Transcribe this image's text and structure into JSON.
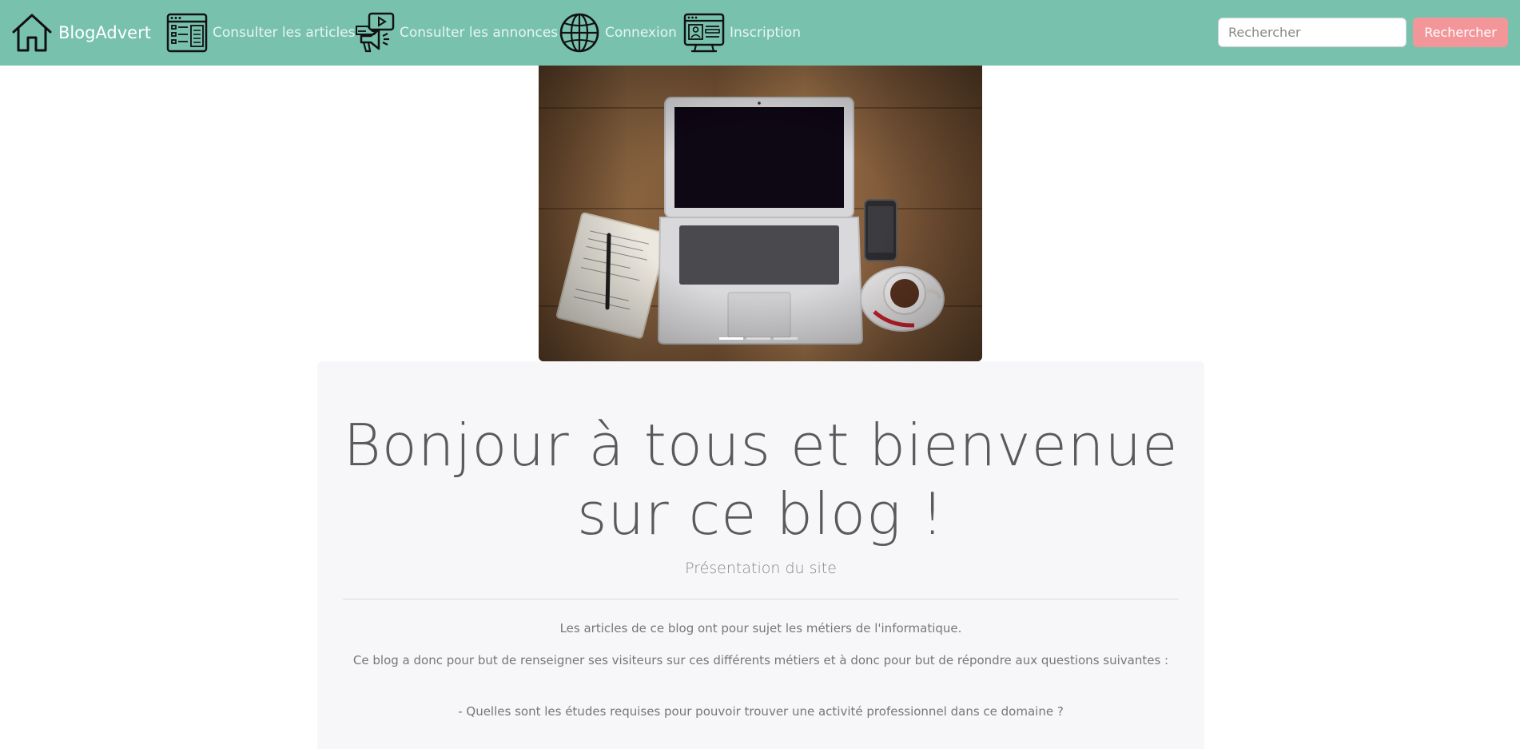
{
  "navbar": {
    "brand": "BlogAdvert",
    "links": [
      {
        "label": "Consulter les articles",
        "icon": "articles-icon"
      },
      {
        "label": "Consulter les annonces",
        "icon": "megaphone-icon"
      },
      {
        "label": "Connexion",
        "icon": "globe-icon"
      },
      {
        "label": "Inscription",
        "icon": "profile-card-icon"
      }
    ],
    "search_placeholder": "Rechercher",
    "search_button": "Rechercher",
    "accent_color": "#78c2ad",
    "button_color": "#f3969a"
  },
  "carousel": {
    "slide_count": 3,
    "active_index": 0
  },
  "jumbotron": {
    "headline_line1": "Bonjour à tous et bienvenue",
    "headline_line2": "sur ce blog !",
    "subtitle": "Présentation du site",
    "paragraphs": [
      "Les articles de ce blog ont pour sujet les métiers de l'informatique.",
      "Ce blog a donc pour but de renseigner ses visiteurs sur ces différents métiers et à donc pour but de répondre aux questions suivantes :",
      "- Quelles sont les études requises pour pouvoir trouver une activité professionnel dans ce domaine ?"
    ]
  }
}
